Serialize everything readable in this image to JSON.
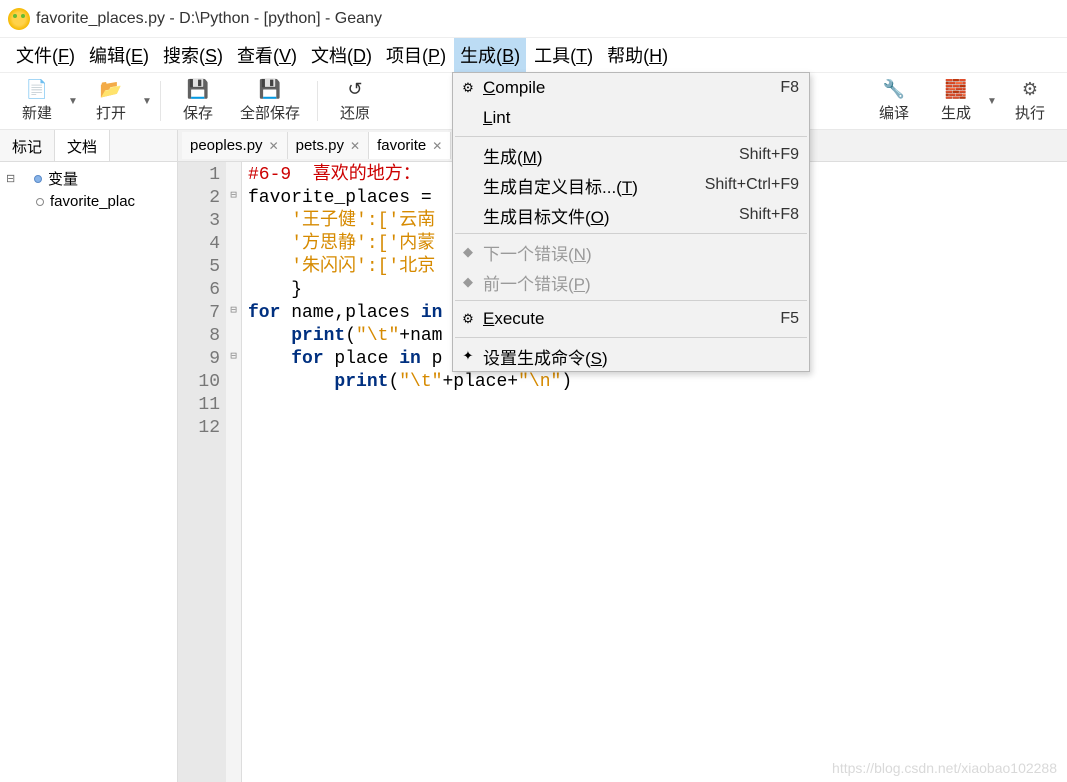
{
  "window": {
    "title": "favorite_places.py - D:\\Python - [python] - Geany"
  },
  "menubar": {
    "items": [
      {
        "pre": "文件(",
        "u": "F",
        "post": ")"
      },
      {
        "pre": "编辑(",
        "u": "E",
        "post": ")"
      },
      {
        "pre": "搜索(",
        "u": "S",
        "post": ")"
      },
      {
        "pre": "查看(",
        "u": "V",
        "post": ")"
      },
      {
        "pre": "文档(",
        "u": "D",
        "post": ")"
      },
      {
        "pre": "项目(",
        "u": "P",
        "post": ")"
      },
      {
        "pre": "生成(",
        "u": "B",
        "post": ")"
      },
      {
        "pre": "工具(",
        "u": "T",
        "post": ")"
      },
      {
        "pre": "帮助(",
        "u": "H",
        "post": ")"
      }
    ],
    "active_index": 6
  },
  "toolbar": {
    "new": "新建",
    "open": "打开",
    "save": "保存",
    "saveall": "全部保存",
    "revert": "还原",
    "compile": "编译",
    "build": "生成",
    "execute": "执行"
  },
  "side_tabs": {
    "a": "标记",
    "b": "文档"
  },
  "tree": {
    "root": "变量",
    "child": "favorite_plac"
  },
  "file_tabs": {
    "items": [
      {
        "name": "peoples.py",
        "active": false
      },
      {
        "name": "pets.py",
        "active": false
      },
      {
        "name": "favorite",
        "active": true
      }
    ]
  },
  "dropdown": {
    "items": [
      {
        "icon": "⚙",
        "label_pre": "",
        "u": "C",
        "label_post": "ompile",
        "short": "F8",
        "disabled": false
      },
      {
        "icon": "",
        "label_pre": "",
        "u": "L",
        "label_post": "int",
        "short": "",
        "disabled": false
      },
      {
        "sep": true
      },
      {
        "icon": "",
        "label_pre": "生成(",
        "u": "M",
        "label_post": ")",
        "short": "Shift+F9",
        "disabled": false
      },
      {
        "icon": "",
        "label_pre": "生成自定义目标...(",
        "u": "T",
        "label_post": ")",
        "short": "Shift+Ctrl+F9",
        "disabled": false
      },
      {
        "icon": "",
        "label_pre": "生成目标文件(",
        "u": "O",
        "label_post": ")",
        "short": "Shift+F8",
        "disabled": false
      },
      {
        "sep": true
      },
      {
        "icon": "◆",
        "label_pre": "下一个错误(",
        "u": "N",
        "label_post": ")",
        "short": "",
        "disabled": true
      },
      {
        "icon": "◆",
        "label_pre": "前一个错误(",
        "u": "P",
        "label_post": ")",
        "short": "",
        "disabled": true
      },
      {
        "sep": true
      },
      {
        "icon": "⚙",
        "label_pre": "",
        "u": "E",
        "label_post": "xecute",
        "short": "F5",
        "disabled": false
      },
      {
        "sep": true
      },
      {
        "icon": "✦",
        "label_pre": "设置生成命令(",
        "u": "S",
        "label_post": ")",
        "short": "",
        "disabled": false
      }
    ]
  },
  "editor": {
    "lines": [
      "1",
      "2",
      "3",
      "4",
      "5",
      "6",
      "7",
      "8",
      "9",
      "10",
      "11",
      "12"
    ],
    "fold": [
      "",
      "⊟",
      "",
      "",
      "",
      "",
      "⊟",
      "",
      "⊟",
      "",
      "",
      ""
    ],
    "code": {
      "l1_comment": "#6-9  喜欢的地方：",
      "l2_a": "favorite_places = ",
      "l3_a": "    '",
      "l3_b": "王子健",
      "l3_c": "':['",
      "l3_d": "云南",
      "l4_a": "    '",
      "l4_b": "方思静",
      "l4_c": "':['",
      "l4_d": "内蒙",
      "l5_a": "    '",
      "l5_b": "朱闪闪",
      "l5_c": "':['",
      "l5_d": "北京",
      "l6": "    }",
      "l7_a": "for",
      "l7_b": " name,places ",
      "l7_c": "in",
      "l8_a": "    ",
      "l8_b": "print",
      "l8_c": "(",
      "l8_d": "\"\\t\"",
      "l8_e": "+nam",
      "l9_a": "    ",
      "l9_b": "for",
      "l9_c": " place ",
      "l9_d": "in",
      "l9_e": " p",
      "l10_a": "        ",
      "l10_b": "print",
      "l10_c": "(",
      "l10_d": "\"\\t\"",
      "l10_e": "+place+",
      "l10_f": "\"\\n\"",
      "l10_g": ")"
    }
  },
  "watermark": "https://blog.csdn.net/xiaobao102288"
}
